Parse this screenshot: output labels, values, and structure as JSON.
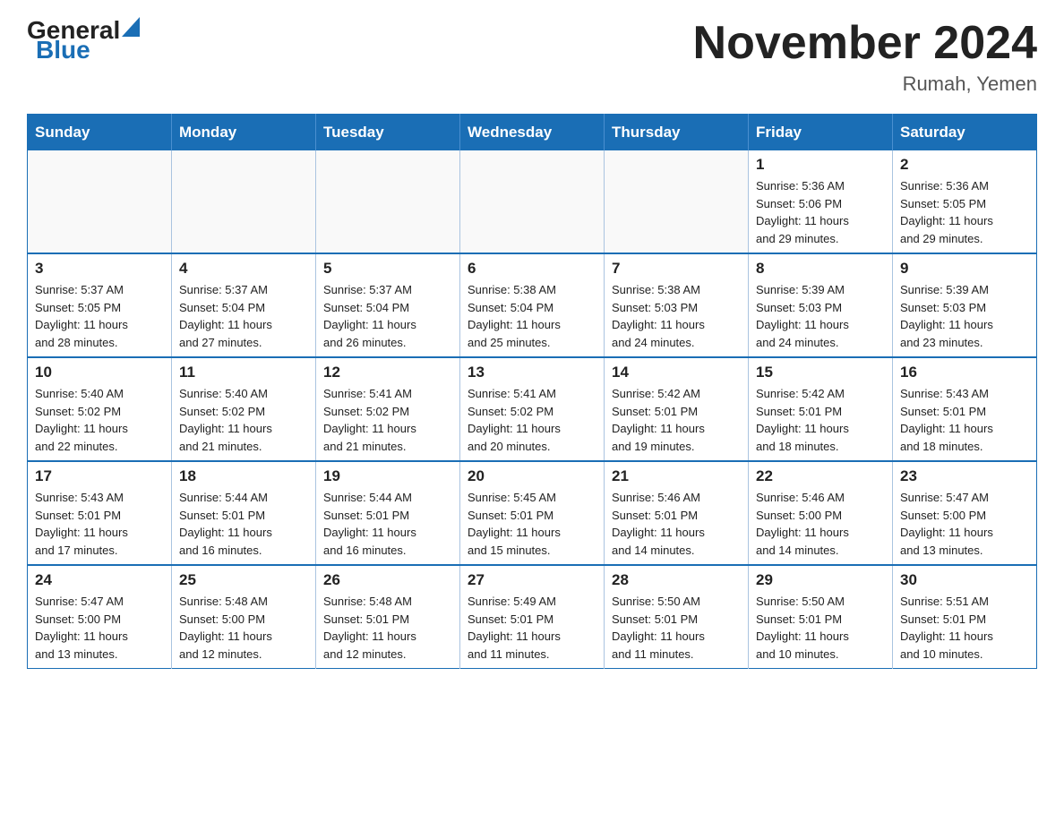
{
  "logo": {
    "general": "General",
    "blue": "Blue"
  },
  "title": "November 2024",
  "subtitle": "Rumah, Yemen",
  "weekdays": [
    "Sunday",
    "Monday",
    "Tuesday",
    "Wednesday",
    "Thursday",
    "Friday",
    "Saturday"
  ],
  "weeks": [
    [
      {
        "day": "",
        "info": ""
      },
      {
        "day": "",
        "info": ""
      },
      {
        "day": "",
        "info": ""
      },
      {
        "day": "",
        "info": ""
      },
      {
        "day": "",
        "info": ""
      },
      {
        "day": "1",
        "info": "Sunrise: 5:36 AM\nSunset: 5:06 PM\nDaylight: 11 hours\nand 29 minutes."
      },
      {
        "day": "2",
        "info": "Sunrise: 5:36 AM\nSunset: 5:05 PM\nDaylight: 11 hours\nand 29 minutes."
      }
    ],
    [
      {
        "day": "3",
        "info": "Sunrise: 5:37 AM\nSunset: 5:05 PM\nDaylight: 11 hours\nand 28 minutes."
      },
      {
        "day": "4",
        "info": "Sunrise: 5:37 AM\nSunset: 5:04 PM\nDaylight: 11 hours\nand 27 minutes."
      },
      {
        "day": "5",
        "info": "Sunrise: 5:37 AM\nSunset: 5:04 PM\nDaylight: 11 hours\nand 26 minutes."
      },
      {
        "day": "6",
        "info": "Sunrise: 5:38 AM\nSunset: 5:04 PM\nDaylight: 11 hours\nand 25 minutes."
      },
      {
        "day": "7",
        "info": "Sunrise: 5:38 AM\nSunset: 5:03 PM\nDaylight: 11 hours\nand 24 minutes."
      },
      {
        "day": "8",
        "info": "Sunrise: 5:39 AM\nSunset: 5:03 PM\nDaylight: 11 hours\nand 24 minutes."
      },
      {
        "day": "9",
        "info": "Sunrise: 5:39 AM\nSunset: 5:03 PM\nDaylight: 11 hours\nand 23 minutes."
      }
    ],
    [
      {
        "day": "10",
        "info": "Sunrise: 5:40 AM\nSunset: 5:02 PM\nDaylight: 11 hours\nand 22 minutes."
      },
      {
        "day": "11",
        "info": "Sunrise: 5:40 AM\nSunset: 5:02 PM\nDaylight: 11 hours\nand 21 minutes."
      },
      {
        "day": "12",
        "info": "Sunrise: 5:41 AM\nSunset: 5:02 PM\nDaylight: 11 hours\nand 21 minutes."
      },
      {
        "day": "13",
        "info": "Sunrise: 5:41 AM\nSunset: 5:02 PM\nDaylight: 11 hours\nand 20 minutes."
      },
      {
        "day": "14",
        "info": "Sunrise: 5:42 AM\nSunset: 5:01 PM\nDaylight: 11 hours\nand 19 minutes."
      },
      {
        "day": "15",
        "info": "Sunrise: 5:42 AM\nSunset: 5:01 PM\nDaylight: 11 hours\nand 18 minutes."
      },
      {
        "day": "16",
        "info": "Sunrise: 5:43 AM\nSunset: 5:01 PM\nDaylight: 11 hours\nand 18 minutes."
      }
    ],
    [
      {
        "day": "17",
        "info": "Sunrise: 5:43 AM\nSunset: 5:01 PM\nDaylight: 11 hours\nand 17 minutes."
      },
      {
        "day": "18",
        "info": "Sunrise: 5:44 AM\nSunset: 5:01 PM\nDaylight: 11 hours\nand 16 minutes."
      },
      {
        "day": "19",
        "info": "Sunrise: 5:44 AM\nSunset: 5:01 PM\nDaylight: 11 hours\nand 16 minutes."
      },
      {
        "day": "20",
        "info": "Sunrise: 5:45 AM\nSunset: 5:01 PM\nDaylight: 11 hours\nand 15 minutes."
      },
      {
        "day": "21",
        "info": "Sunrise: 5:46 AM\nSunset: 5:01 PM\nDaylight: 11 hours\nand 14 minutes."
      },
      {
        "day": "22",
        "info": "Sunrise: 5:46 AM\nSunset: 5:00 PM\nDaylight: 11 hours\nand 14 minutes."
      },
      {
        "day": "23",
        "info": "Sunrise: 5:47 AM\nSunset: 5:00 PM\nDaylight: 11 hours\nand 13 minutes."
      }
    ],
    [
      {
        "day": "24",
        "info": "Sunrise: 5:47 AM\nSunset: 5:00 PM\nDaylight: 11 hours\nand 13 minutes."
      },
      {
        "day": "25",
        "info": "Sunrise: 5:48 AM\nSunset: 5:00 PM\nDaylight: 11 hours\nand 12 minutes."
      },
      {
        "day": "26",
        "info": "Sunrise: 5:48 AM\nSunset: 5:01 PM\nDaylight: 11 hours\nand 12 minutes."
      },
      {
        "day": "27",
        "info": "Sunrise: 5:49 AM\nSunset: 5:01 PM\nDaylight: 11 hours\nand 11 minutes."
      },
      {
        "day": "28",
        "info": "Sunrise: 5:50 AM\nSunset: 5:01 PM\nDaylight: 11 hours\nand 11 minutes."
      },
      {
        "day": "29",
        "info": "Sunrise: 5:50 AM\nSunset: 5:01 PM\nDaylight: 11 hours\nand 10 minutes."
      },
      {
        "day": "30",
        "info": "Sunrise: 5:51 AM\nSunset: 5:01 PM\nDaylight: 11 hours\nand 10 minutes."
      }
    ]
  ]
}
